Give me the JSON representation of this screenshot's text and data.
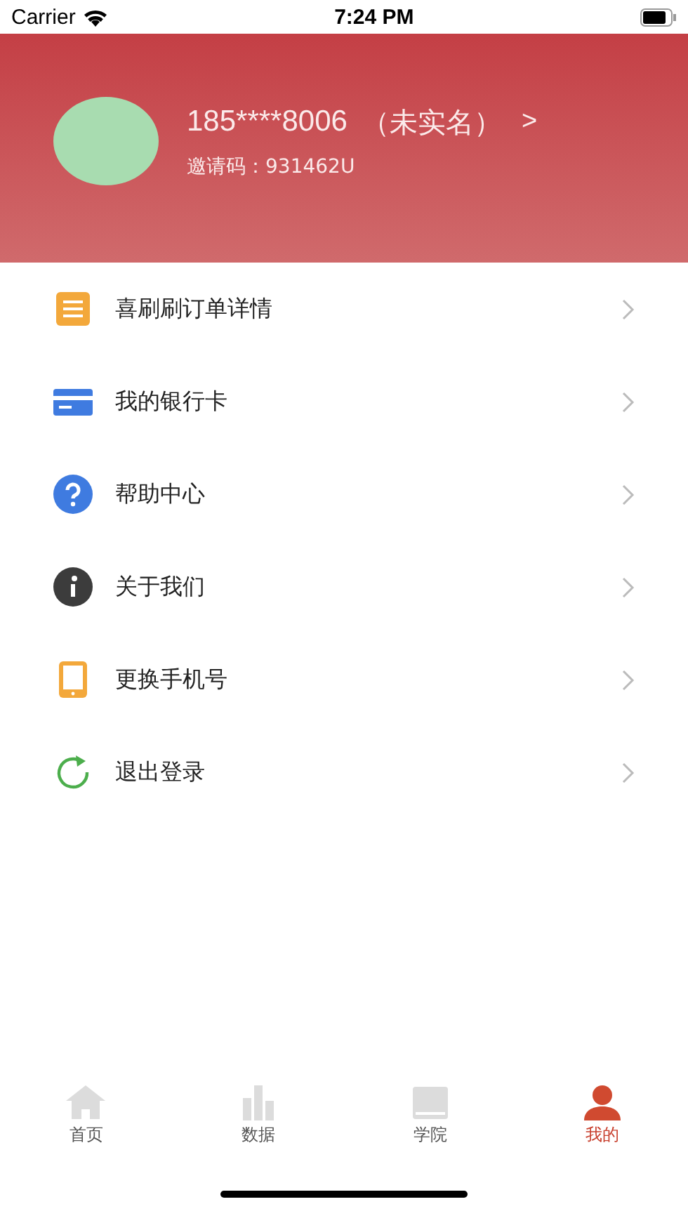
{
  "status_bar": {
    "carrier": "Carrier",
    "time": "7:24 PM"
  },
  "profile": {
    "phone": "185****8006",
    "verify_status": "（未实名）",
    "arrow": ">",
    "invite_label": "邀请码：",
    "invite_code": "931462U"
  },
  "menu": [
    {
      "kind": "list",
      "label": "喜刷刷订单详情"
    },
    {
      "kind": "card",
      "label": "我的银行卡"
    },
    {
      "kind": "help",
      "label": "帮助中心"
    },
    {
      "kind": "info",
      "label": "关于我们"
    },
    {
      "kind": "phone",
      "label": "更换手机号"
    },
    {
      "kind": "logout",
      "label": "退出登录"
    }
  ],
  "tab_bar": [
    {
      "kind": "home",
      "label": "首页",
      "selected": false
    },
    {
      "kind": "data",
      "label": "数据",
      "selected": false
    },
    {
      "kind": "academy",
      "label": "学院",
      "selected": false
    },
    {
      "kind": "me",
      "label": "我的",
      "selected": true
    }
  ]
}
